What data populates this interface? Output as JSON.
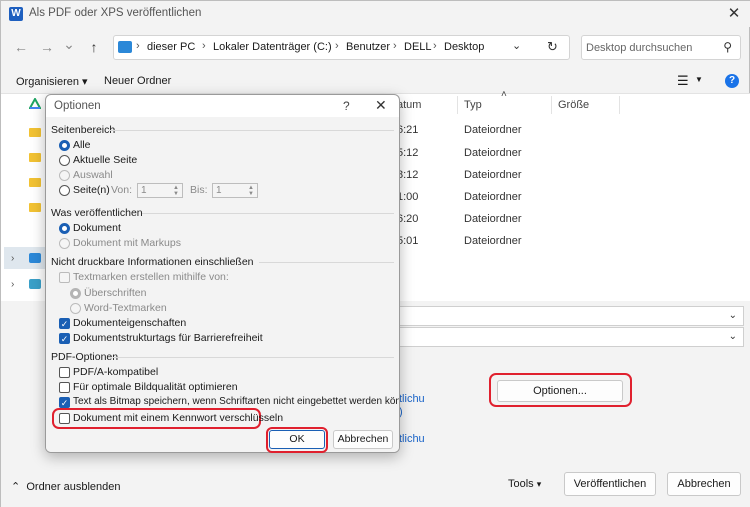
{
  "window": {
    "title": "Als PDF oder XPS veröffentlichen",
    "app_icon_letter": "W"
  },
  "nav": {
    "back_icon": "←",
    "forward_icon": "→",
    "dropdown_icon": "⌄",
    "up_icon": "↑",
    "breadcrumb": [
      "dieser PC",
      "Lokaler Datenträger (C:)",
      "Benutzer",
      "DELL",
      "Desktop"
    ],
    "refresh_icon": "↻",
    "search_placeholder": "Desktop durchsuchen"
  },
  "toolbar": {
    "organize": "Organisieren ▾",
    "new_folder": "Neuer Ordner"
  },
  "file_list": {
    "columns": [
      "atum",
      "Typ",
      "Größe"
    ],
    "rows": [
      {
        "time": "6:21",
        "type": "Dateiordner"
      },
      {
        "time": "5:12",
        "type": "Dateiordner"
      },
      {
        "time": "8:12",
        "type": "Dateiordner"
      },
      {
        "time": "1:00",
        "type": "Dateiordner"
      },
      {
        "time": "6:20",
        "type": "Dateiordner"
      },
      {
        "time": "5:01",
        "type": "Dateiordner"
      }
    ]
  },
  "form": {
    "link1_a": "tlichu",
    "link1_b": ")",
    "link2": "tlichu",
    "options_button": "Optionen..."
  },
  "bottom": {
    "hide_folders": "Ordner ausblenden",
    "tools": "Tools",
    "publish": "Veröffentlichen",
    "cancel": "Abbrechen"
  },
  "dialog": {
    "title": "Optionen",
    "help": "?",
    "close": "✕",
    "page_range": {
      "heading": "Seitenbereich",
      "all": "Alle",
      "current": "Aktuelle Seite",
      "selection": "Auswahl",
      "pages": "Seite(n)",
      "from_label": "Von:",
      "from_value": "1",
      "to_label": "Bis:",
      "to_value": "1"
    },
    "publish_what": {
      "heading": "Was veröffentlichen",
      "document": "Dokument",
      "document_markup": "Dokument mit Markups"
    },
    "non_printable": {
      "heading": "Nicht druckbare Informationen einschließen",
      "create_bookmarks": "Textmarken erstellen mithilfe von:",
      "headings": "Überschriften",
      "word_bookmarks": "Word-Textmarken",
      "doc_properties": "Dokumenteigenschaften",
      "structure_tags": "Dokumentstrukturtags für Barrierefreiheit"
    },
    "pdf_options": {
      "heading": "PDF-Optionen",
      "pdfa": "PDF/A-kompatibel",
      "image_quality": "Für optimale Bildqualität optimieren",
      "bitmap_text": "Text als Bitmap speichern, wenn Schriftarten nicht eingebettet werden können",
      "encrypt": "Dokument mit einem Kennwort verschlüsseln"
    },
    "ok": "OK",
    "cancel": "Abbrechen"
  }
}
